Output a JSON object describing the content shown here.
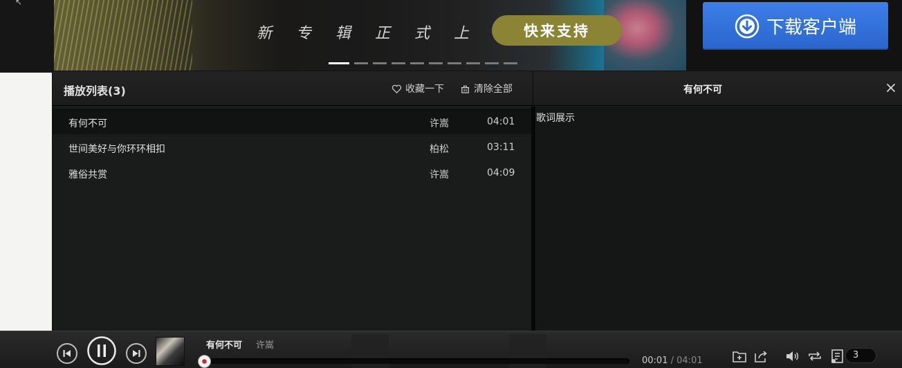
{
  "banner": {
    "text": "新 专 辑 正 式 上 线",
    "cta": "快来支持",
    "dots_count": 10,
    "active_dot": 0
  },
  "download": {
    "label": "下载客户端",
    "icon": "download-icon",
    "color": "#3a7ae4"
  },
  "playlist": {
    "title": "播放列表(3)",
    "collect_label": "收藏一下",
    "clear_label": "清除全部",
    "songs": [
      {
        "title": "有何不可",
        "artist": "许嵩",
        "duration": "04:01",
        "active": true
      },
      {
        "title": "世间美好与你环环相扣",
        "artist": "柏松",
        "duration": "03:11",
        "active": false
      },
      {
        "title": "雅俗共赏",
        "artist": "许嵩",
        "duration": "04:09",
        "active": false
      }
    ]
  },
  "lyrics": {
    "song_title": "有何不可",
    "placeholder": "歌词展示"
  },
  "player": {
    "title": "有何不可",
    "artist": "许嵩",
    "current_time": "00:01",
    "total_time": "04:01",
    "time_separator": "/",
    "playlist_count": "3",
    "progress_fraction": 0.004,
    "accent": "#b83232"
  }
}
